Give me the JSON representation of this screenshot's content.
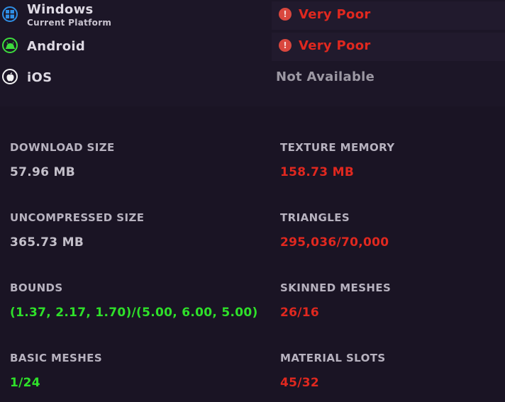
{
  "platforms": [
    {
      "name": "Windows",
      "subtitle": "Current Platform",
      "icon": "windows-icon",
      "rating": "Very Poor"
    },
    {
      "name": "Android",
      "icon": "android-icon",
      "rating": "Very Poor"
    },
    {
      "name": "iOS",
      "icon": "apple-icon",
      "rating": "Not Available"
    }
  ],
  "stats": {
    "download_size": {
      "label": "DOWNLOAD SIZE",
      "value": "57.96 MB"
    },
    "texture_memory": {
      "label": "TEXTURE MEMORY",
      "value": "158.73 MB"
    },
    "uncompressed_size": {
      "label": "UNCOMPRESSED SIZE",
      "value": "365.73 MB"
    },
    "triangles": {
      "label": "TRIANGLES",
      "value": "295,036/70,000"
    },
    "bounds": {
      "label": "BOUNDS",
      "value": "(1.37, 2.17, 1.70)/(5.00, 6.00, 5.00)"
    },
    "skinned_meshes": {
      "label": "SKINNED MESHES",
      "value": "26/16"
    },
    "basic_meshes": {
      "label": "BASIC MESHES",
      "value": "1/24"
    },
    "material_slots": {
      "label": "MATERIAL SLOTS",
      "value": "45/32"
    }
  },
  "colors": {
    "bad": "#e0281f",
    "good": "#2fe02a",
    "neutral": "#c3bfc9",
    "windows": "#2f8fe6",
    "android": "#3ddc3d",
    "ios": "#f2f2f2"
  }
}
